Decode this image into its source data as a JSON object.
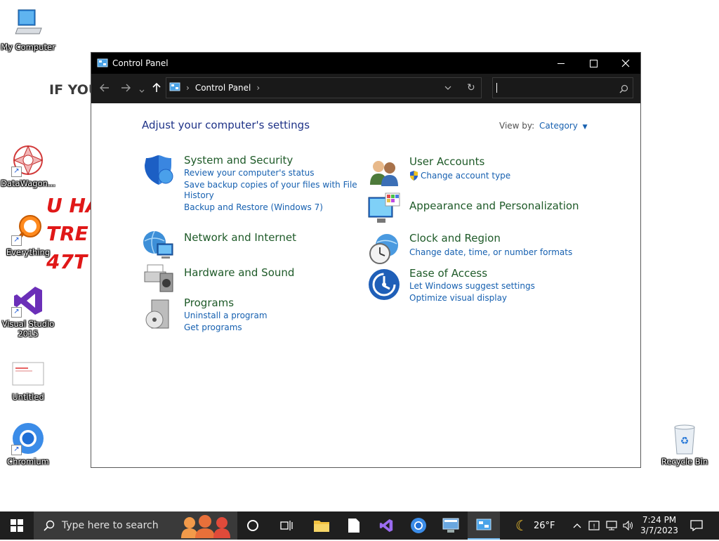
{
  "desktop": {
    "icons": [
      {
        "label": "My Computer"
      },
      {
        "label": "DataWagon..."
      },
      {
        "label": "Everything"
      },
      {
        "label": "Visual Studio 2015"
      },
      {
        "label": "Untitled"
      },
      {
        "label": "Chromium"
      },
      {
        "label": "Recycle Bin"
      }
    ],
    "wallpaper_text": {
      "line1": "IF YOU",
      "line2": "U HA",
      "line3": "TRE",
      "line4": "47T"
    }
  },
  "window": {
    "title": "Control Panel",
    "address": {
      "breadcrumb": "Control Panel",
      "separator": "›"
    },
    "search": {
      "placeholder": ""
    },
    "content": {
      "heading": "Adjust your computer's settings",
      "view_by_label": "View by:",
      "view_by_value": "Category",
      "left_categories": [
        {
          "title": "System and Security",
          "links": [
            "Review your computer's status",
            "Save backup copies of your files with File",
            "History",
            "Backup and Restore (Windows 7)"
          ]
        },
        {
          "title": "Network and Internet",
          "links": []
        },
        {
          "title": "Hardware and Sound",
          "links": []
        },
        {
          "title": "Programs",
          "links": [
            "Uninstall a program",
            "Get programs"
          ]
        }
      ],
      "right_categories": [
        {
          "title": "User Accounts",
          "links": [
            "Change account type"
          ]
        },
        {
          "title": "Appearance and Personalization",
          "links": []
        },
        {
          "title": "Clock and Region",
          "links": [
            "Change date, time, or number formats"
          ]
        },
        {
          "title": "Ease of Access",
          "links": [
            "Let Windows suggest settings",
            "Optimize visual display"
          ]
        }
      ]
    }
  },
  "taskbar": {
    "search_placeholder": "Type here to search",
    "weather": "26°F",
    "time": "7:24 PM",
    "date": "3/7/2023"
  },
  "colors": {
    "link": "#1660b0",
    "category_title": "#1e5a28",
    "heading": "#1e3287",
    "titlebar": "#000000",
    "taskbar": "#1f1f1f"
  }
}
